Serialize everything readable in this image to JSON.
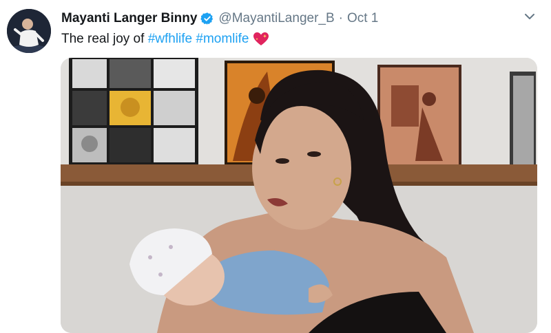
{
  "tweet": {
    "display_name": "Mayanti Langer Binny",
    "handle": "@MayantiLanger_B",
    "separator": "·",
    "date": "Oct 1",
    "text_plain": "The real joy of",
    "hashtags": [
      "#wfhlife",
      "#momlife"
    ],
    "emoji": "sparkling-heart-icon"
  },
  "icons": {
    "verified": "verified-badge-icon",
    "menu": "chevron-down-icon"
  },
  "colors": {
    "link": "#1da1f2",
    "verified": "#1da1f2",
    "name": "#14171a",
    "meta": "#657786",
    "heart": "#e0245e"
  }
}
